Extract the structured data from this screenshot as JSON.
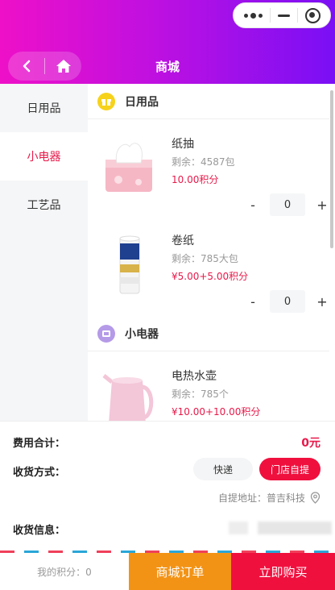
{
  "header": {
    "title": "商城",
    "capsule_icons": [
      "more-dots-icon",
      "minimize-icon",
      "close-target-icon"
    ],
    "nav_icons": [
      "back-chevron-icon",
      "home-icon"
    ]
  },
  "sidebar": {
    "items": [
      {
        "label": "日用品",
        "active": false
      },
      {
        "label": "小电器",
        "active": true
      },
      {
        "label": "工艺品",
        "active": false
      }
    ]
  },
  "categories": [
    {
      "title": "日用品",
      "icon": "gift-icon",
      "products": [
        {
          "name": "纸抽",
          "stock": "剩余：4587包",
          "price": "10.00积分",
          "qty": "0",
          "minus": "-",
          "plus": "+"
        },
        {
          "name": "卷纸",
          "stock": "剩余：785大包",
          "price": "¥5.00+5.00积分",
          "qty": "0",
          "minus": "-",
          "plus": "+"
        }
      ]
    },
    {
      "title": "小电器",
      "icon": "appliance-icon",
      "products": [
        {
          "name": "电热水壶",
          "stock": "剩余：785个",
          "price": "¥10.00+10.00积分"
        }
      ]
    }
  ],
  "summary": {
    "total_label": "费用合计：",
    "total_value": "0元",
    "delivery_label": "收货方式：",
    "delivery_options": [
      {
        "label": "快递",
        "selected": false
      },
      {
        "label": "门店自提",
        "selected": true
      }
    ],
    "pickup_address": "自提地址：普吉科技",
    "receiver_label": "收货信息："
  },
  "bottom_bar": {
    "points": "我的积分：0",
    "orders_label": "商城订单",
    "buy_label": "立即购买"
  },
  "colors": {
    "header_gradient_start": "#ee10c8",
    "header_gradient_end": "#7a0ff5",
    "accent_red": "#f0103e",
    "accent_orange": "#f39316"
  }
}
